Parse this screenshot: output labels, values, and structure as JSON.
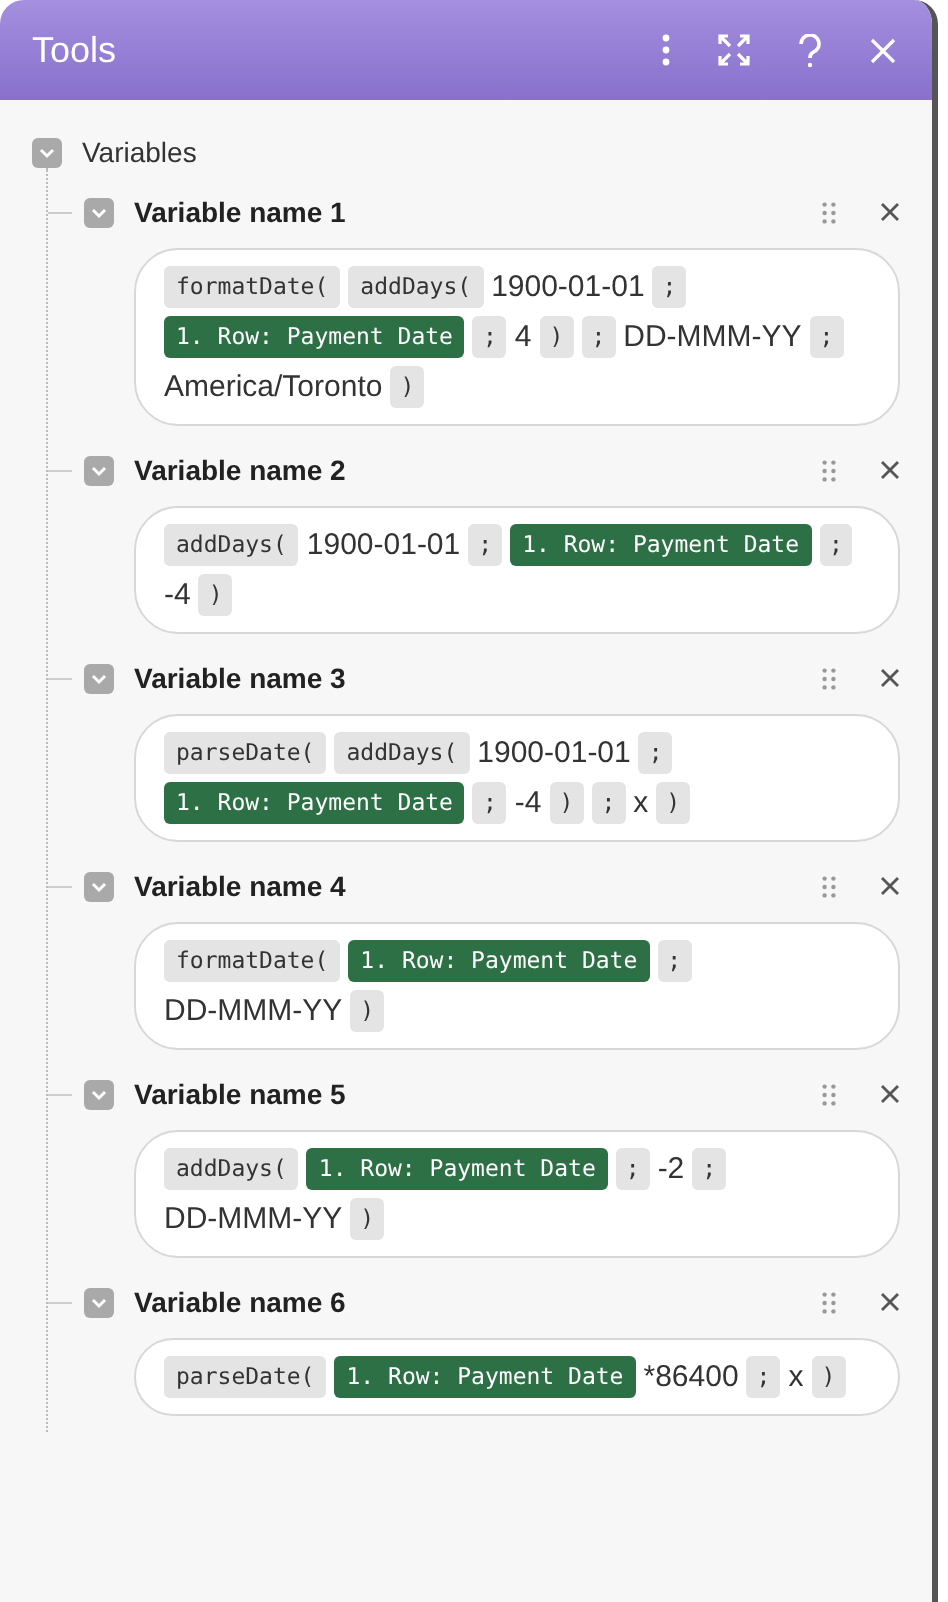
{
  "window": {
    "title": "Tools"
  },
  "section": {
    "label": "Variables",
    "expanded": true
  },
  "variables": [
    {
      "name": "Variable name 1",
      "expanded": true,
      "tokens": [
        {
          "kind": "func",
          "text": "formatDate("
        },
        {
          "kind": "func",
          "text": "addDays("
        },
        {
          "kind": "text",
          "text": "1900-01-01"
        },
        {
          "kind": "sep",
          "text": ";"
        },
        {
          "kind": "field",
          "text": "1. Row: Payment Date"
        },
        {
          "kind": "sep",
          "text": ";"
        },
        {
          "kind": "text",
          "text": "4"
        },
        {
          "kind": "sep",
          "text": ")"
        },
        {
          "kind": "sep",
          "text": ";"
        },
        {
          "kind": "text",
          "text": "DD-MMM-YY"
        },
        {
          "kind": "sep",
          "text": ";"
        },
        {
          "kind": "text",
          "text": "America/Toronto"
        },
        {
          "kind": "sep",
          "text": ")"
        }
      ]
    },
    {
      "name": "Variable name 2",
      "expanded": true,
      "tokens": [
        {
          "kind": "func",
          "text": "addDays("
        },
        {
          "kind": "text",
          "text": "1900-01-01"
        },
        {
          "kind": "sep",
          "text": ";"
        },
        {
          "kind": "field",
          "text": "1. Row: Payment Date"
        },
        {
          "kind": "sep",
          "text": ";"
        },
        {
          "kind": "text",
          "text": "-4"
        },
        {
          "kind": "sep",
          "text": ")"
        }
      ]
    },
    {
      "name": "Variable name 3",
      "expanded": true,
      "tokens": [
        {
          "kind": "func",
          "text": "parseDate("
        },
        {
          "kind": "func",
          "text": "addDays("
        },
        {
          "kind": "text",
          "text": "1900-01-01"
        },
        {
          "kind": "sep",
          "text": ";"
        },
        {
          "kind": "field",
          "text": "1. Row: Payment Date"
        },
        {
          "kind": "sep",
          "text": ";"
        },
        {
          "kind": "text",
          "text": "-4"
        },
        {
          "kind": "sep",
          "text": ")"
        },
        {
          "kind": "sep",
          "text": ";"
        },
        {
          "kind": "text",
          "text": "x"
        },
        {
          "kind": "sep",
          "text": ")"
        }
      ]
    },
    {
      "name": "Variable name 4",
      "expanded": true,
      "tokens": [
        {
          "kind": "func",
          "text": "formatDate("
        },
        {
          "kind": "field",
          "text": "1. Row: Payment Date"
        },
        {
          "kind": "sep",
          "text": ";"
        },
        {
          "kind": "text",
          "text": "DD-MMM-YY"
        },
        {
          "kind": "sep",
          "text": ")"
        }
      ]
    },
    {
      "name": "Variable name 5",
      "expanded": true,
      "tokens": [
        {
          "kind": "func",
          "text": "addDays("
        },
        {
          "kind": "field",
          "text": "1. Row: Payment Date"
        },
        {
          "kind": "sep",
          "text": ";"
        },
        {
          "kind": "text",
          "text": "-2"
        },
        {
          "kind": "sep",
          "text": ";"
        },
        {
          "kind": "text",
          "text": "DD-MMM-YY"
        },
        {
          "kind": "sep",
          "text": ")"
        }
      ]
    },
    {
      "name": "Variable name 6",
      "expanded": true,
      "tokens": [
        {
          "kind": "func",
          "text": "parseDate("
        },
        {
          "kind": "field",
          "text": "1. Row: Payment Date"
        },
        {
          "kind": "text",
          "text": "*86400"
        },
        {
          "kind": "sep",
          "text": ";"
        },
        {
          "kind": "text",
          "text": "x"
        },
        {
          "kind": "sep",
          "text": ")"
        }
      ]
    }
  ]
}
